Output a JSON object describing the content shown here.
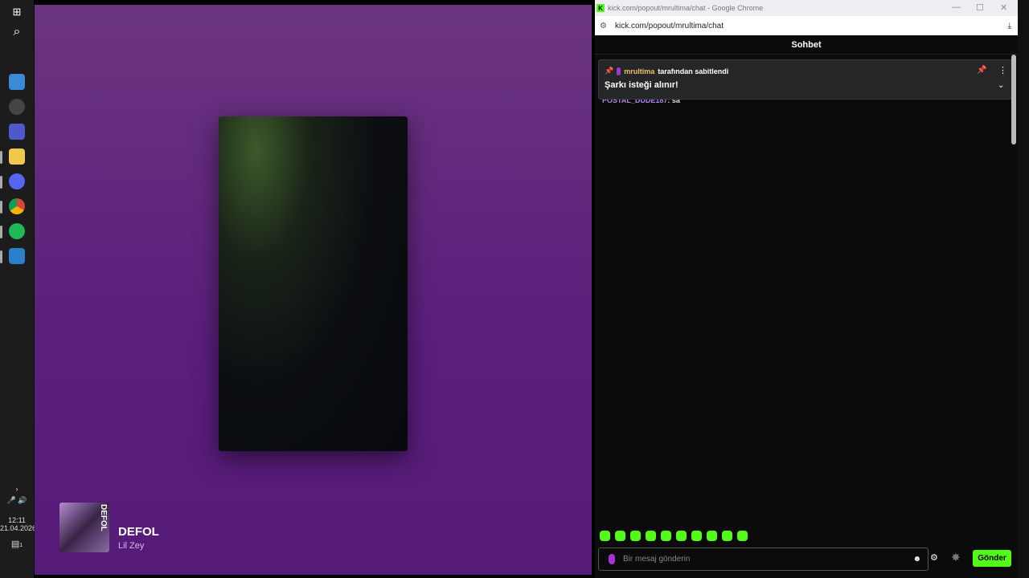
{
  "taskbar": {
    "icons": [
      "windows-icon",
      "search-icon",
      "app-icon",
      "clock-app-icon",
      "teams-icon",
      "file-explorer-icon",
      "discord-icon",
      "chrome-icon",
      "spotify-icon",
      "app2-icon"
    ],
    "time": "12:11",
    "date": "21.04.2026",
    "notification_count": "1"
  },
  "spotify": {
    "track_title": "DEFOL",
    "artist": "Lil Zey",
    "cover_text": "DEFOL"
  },
  "browser": {
    "window_title": "kick.com/popout/mrultima/chat - Google Chrome",
    "url": "kick.com/popout/mrultima/chat",
    "favicon": "K"
  },
  "chat": {
    "header": "Sohbet",
    "pinned": {
      "user": "mrultima",
      "pinned_by_text": "tarafından sabitlendi",
      "message": "Şarkı isteği alınır!"
    },
    "messages": [
      {
        "user": "POSTAL_DUDE187",
        "text": ": sa"
      }
    ],
    "input_placeholder": "Bir mesaj gönderin",
    "send_label": "Gönder"
  },
  "colors": {
    "kick_green": "#53fc18",
    "spotify_bg": "#5a1e7c",
    "pinned_user": "#f0c26a"
  }
}
